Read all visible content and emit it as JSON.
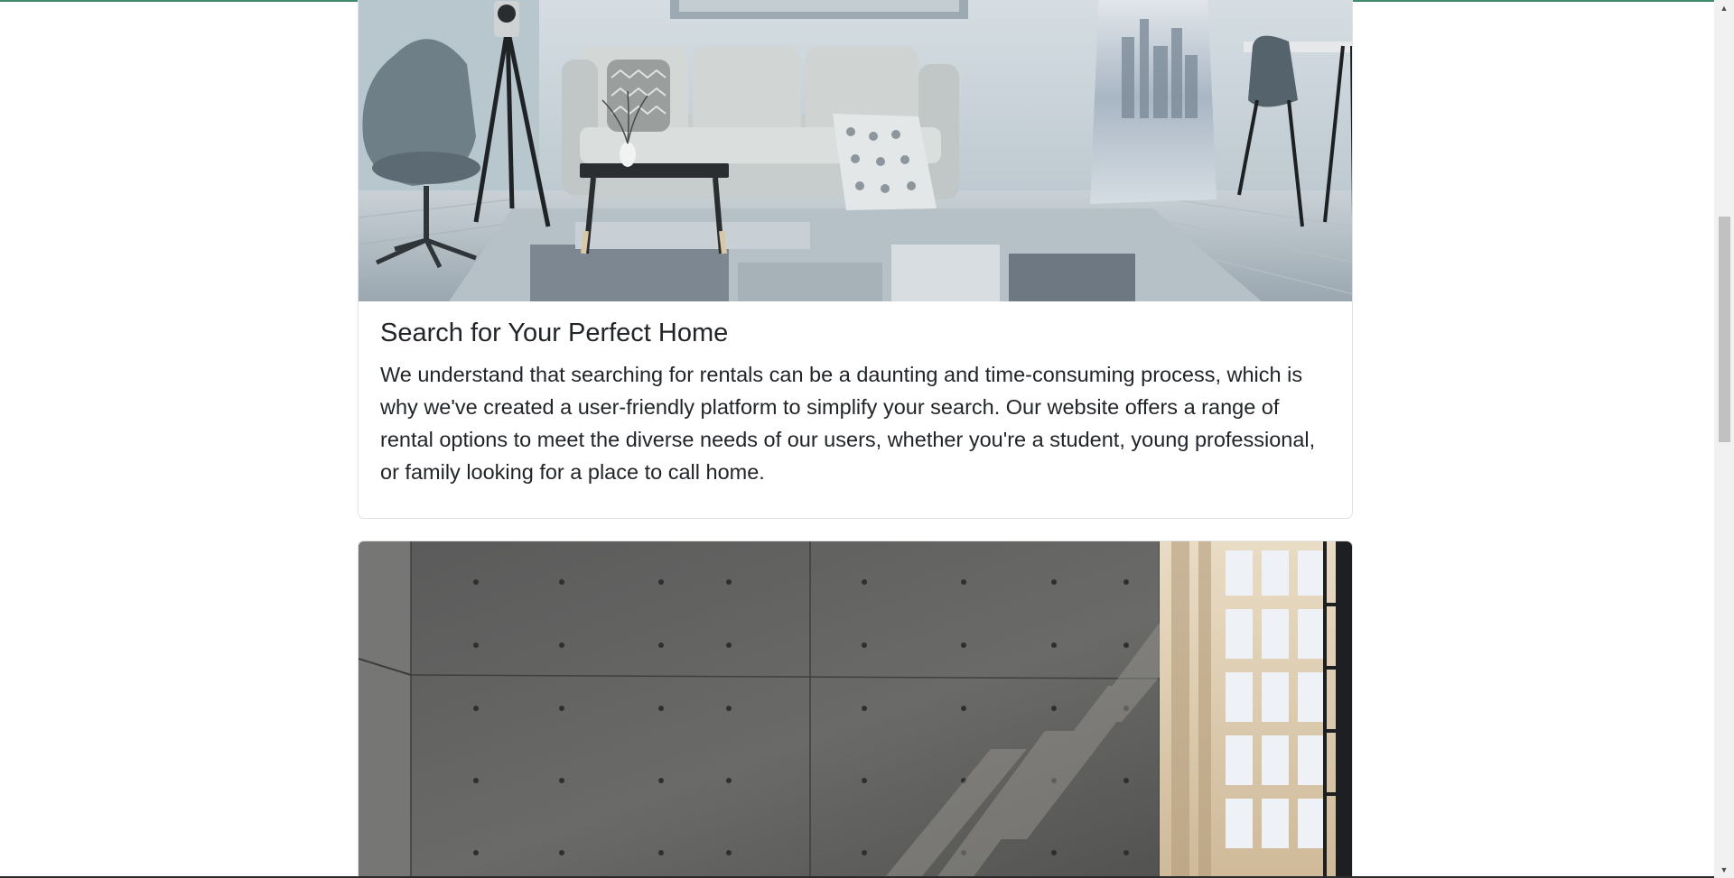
{
  "cards": [
    {
      "image_alt": "Modern living room with grey sofa, egg chair, tripod lamp and rug",
      "title": "Search for Your Perfect Home",
      "text": "We understand that searching for rentals can be a daunting and time-consuming process, which is why we've created a user-friendly platform to simplify your search. Our website offers a range of rental options to meet the diverse needs of our users, whether you're a student, young professional, or family looking for a place to call home."
    },
    {
      "image_alt": "Minimalist bedroom with concrete walls and tall windows casting shadows"
    }
  ],
  "colors": {
    "accent_top": "#3f8a6b",
    "text": "#212529",
    "card_border": "#dfe2e6"
  },
  "scrollbar": {
    "up_icon": "triangle-up",
    "down_icon": "triangle-down"
  }
}
